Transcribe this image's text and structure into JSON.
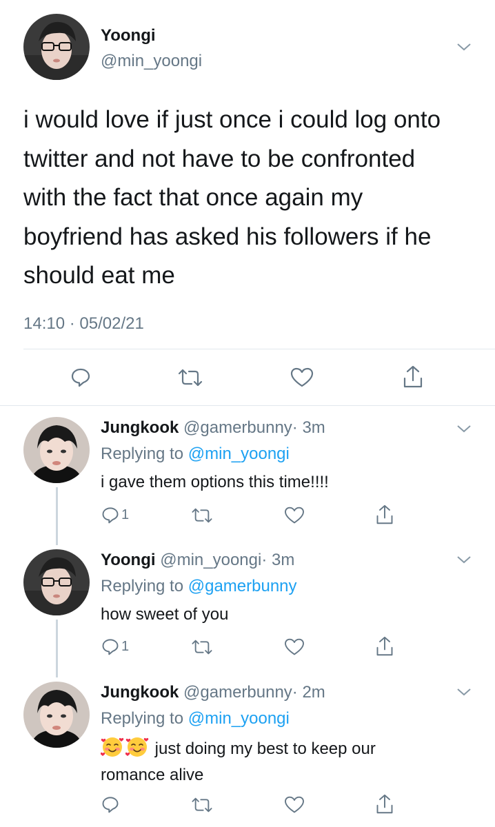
{
  "main_tweet": {
    "name": "Yoongi",
    "handle": "@min_yoongi",
    "text": "i would love if just once i could log onto twitter and not have to be confronted with the fact that once again my boyfriend has asked his followers if he should eat me",
    "timestamp": "14:10 · 05/02/21",
    "actions": [
      "reply-icon",
      "retweet-icon",
      "like-icon",
      "share-icon"
    ]
  },
  "replies": [
    {
      "name": "Jungkook",
      "handle": "@gamerbunny",
      "time": "· 3m",
      "replying_prefix": "Replying to ",
      "replying_to": "@min_yoongi",
      "text": "i gave them options this time!!!!",
      "reply_count": "1"
    },
    {
      "name": "Yoongi",
      "handle": "@min_yoongi",
      "time": "· 3m",
      "replying_prefix": "Replying to ",
      "replying_to": "@gamerbunny",
      "text": "how sweet of you",
      "reply_count": "1"
    },
    {
      "name": "Jungkook",
      "handle": "@gamerbunny",
      "time": "· 2m",
      "replying_prefix": "Replying to ",
      "replying_to": "@min_yoongi",
      "emoji": [
        "smiling-face-with-hearts",
        "smiling-face-with-hearts"
      ],
      "text": "just doing my best to keep our romance alive",
      "reply_count": ""
    }
  ],
  "colors": {
    "text": "#14171a",
    "secondary": "#657786",
    "link": "#1da1f2",
    "divider": "#e1e8ed",
    "thread_line": "#ccd6dd"
  }
}
